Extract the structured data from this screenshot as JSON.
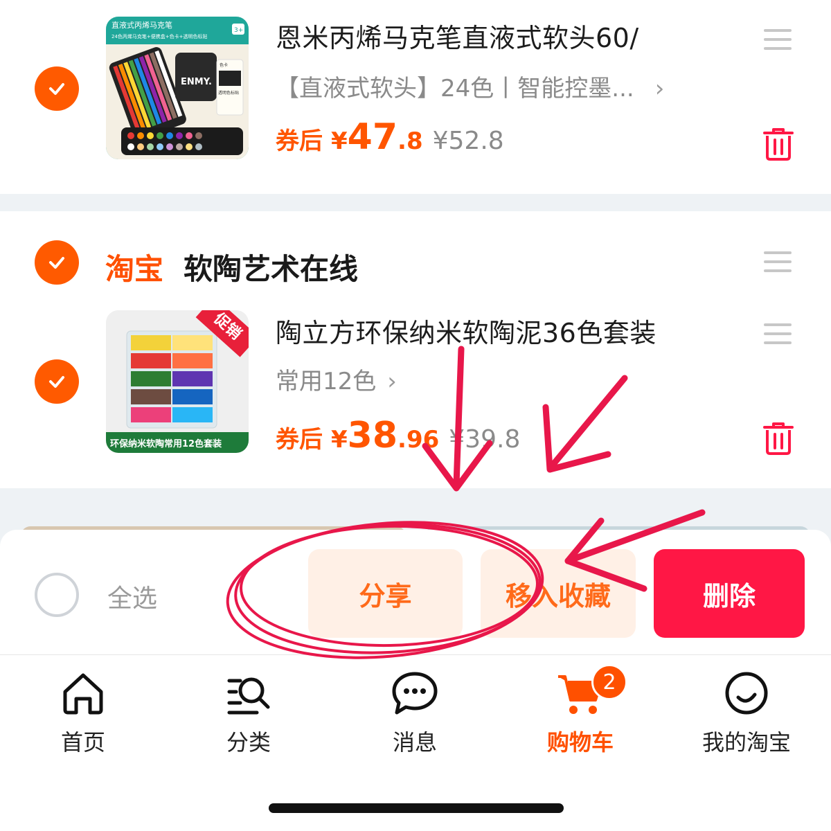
{
  "items": [
    {
      "title": "恩米丙烯马克笔直液式软头60/",
      "sku": "【直液式软头】24色丨智能控墨...",
      "coupon_tag": "券后",
      "currency": "¥",
      "price_int": "47",
      "price_dec": ".8",
      "original_price": "¥52.8",
      "thumb": {
        "header": "直液式丙烯马克笔",
        "sub": "24色丙烯马克笔+便携盒+色卡+透明色标贴",
        "age": "3+",
        "brand": "ENMY.",
        "card_label": "色卡",
        "sticker_label": "透明色标贴"
      }
    },
    {
      "title": "陶立方环保纳米软陶泥36色套装",
      "sku": "常用12色",
      "coupon_tag": "券后",
      "currency": "¥",
      "price_int": "38",
      "price_dec": ".96",
      "original_price": "¥39.8",
      "thumb": {
        "promo": "促销",
        "caption": "环保纳米软陶常用12色套装"
      }
    }
  ],
  "shop": {
    "logo_text": "淘宝",
    "name": "软陶艺术在线"
  },
  "bottom_bar": {
    "select_all": "全选",
    "share": "分享",
    "move_to_favorites": "移入收藏",
    "delete": "删除"
  },
  "tabs": [
    {
      "label": "首页",
      "icon": "home-icon"
    },
    {
      "label": "分类",
      "icon": "category-search-icon"
    },
    {
      "label": "消息",
      "icon": "message-icon"
    },
    {
      "label": "购物车",
      "icon": "cart-icon",
      "badge": "2",
      "active": true
    },
    {
      "label": "我的淘宝",
      "icon": "profile-smile-icon"
    }
  ],
  "colors": {
    "accent": "#ff5000",
    "delete": "#ff1745",
    "annotation": "#e8174a"
  }
}
